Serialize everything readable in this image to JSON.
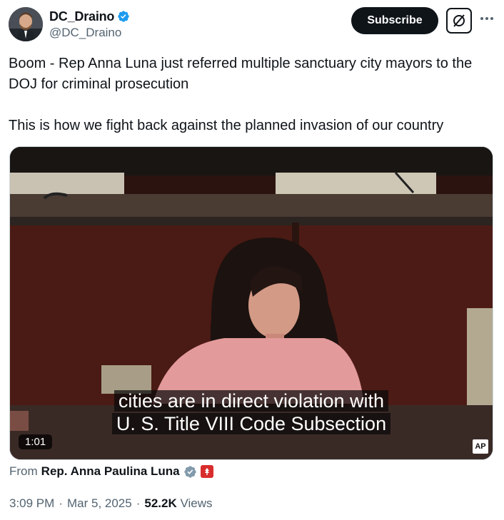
{
  "author": {
    "display_name": "DC_Draino",
    "handle": "@DC_Draino",
    "verified_icon": "verified-badge-icon",
    "avatar": "avatar"
  },
  "actions": {
    "subscribe_label": "Subscribe",
    "grok_icon": "grok-icon",
    "more_icon": "more-icon"
  },
  "tweet": {
    "paragraph_1": "Boom - Rep Anna Luna just referred multiple sanctuary city mayors to the DOJ for criminal prosecution",
    "paragraph_2": "This is how we fight back against the planned invasion of our country"
  },
  "media": {
    "caption_line_1": "cities are in direct violation with",
    "caption_line_2": "U. S. Title VIII Code Subsection",
    "duration": "1:01",
    "watermark": "AP"
  },
  "source": {
    "prefix": "From",
    "name": "Rep. Anna Paulina Luna",
    "badge_icon": "government-badge-icon",
    "affiliation_icon": "affiliation-icon"
  },
  "meta": {
    "time": "3:09 PM",
    "separator": "·",
    "date": "Mar 5, 2025",
    "views_count": "52.2K",
    "views_label": "Views"
  },
  "colors": {
    "text": "#0f1419",
    "secondary": "#536471",
    "verified_blue": "#1d9bf0",
    "gov_gray": "#829aab",
    "subscribe_bg": "#0f1419"
  }
}
